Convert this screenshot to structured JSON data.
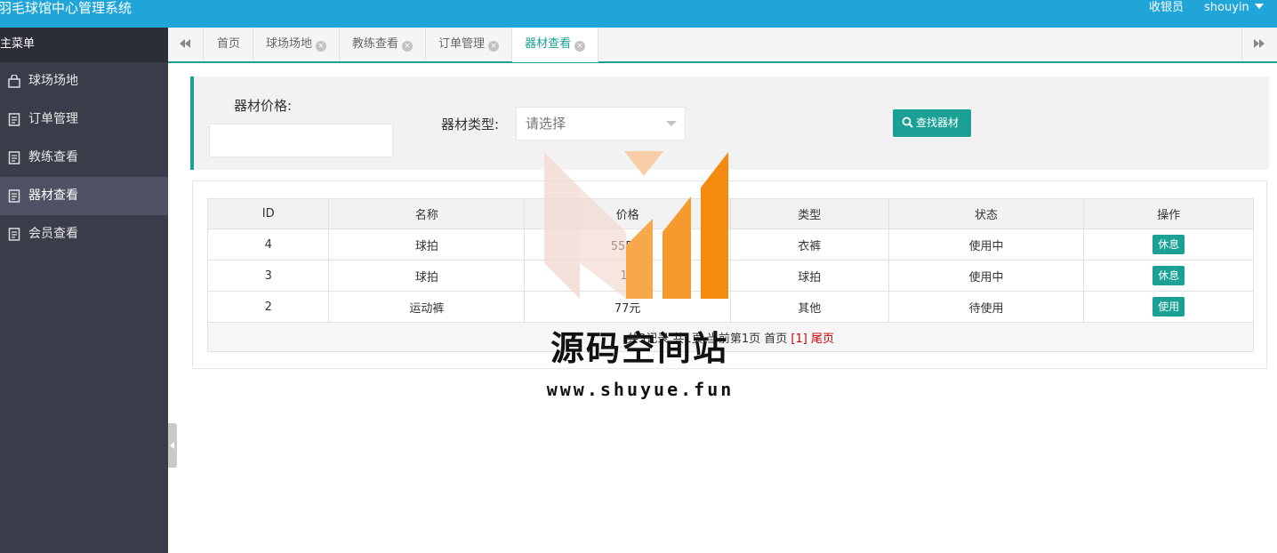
{
  "app": {
    "title": "羽毛球馆中心管理系统",
    "role": "收银员",
    "username": "shouyin"
  },
  "sidebar": {
    "header": "主菜单",
    "items": [
      {
        "label": "球场场地",
        "icon": "bag-icon",
        "active": false
      },
      {
        "label": "订单管理",
        "icon": "document-icon",
        "active": false
      },
      {
        "label": "教练查看",
        "icon": "document-icon",
        "active": false
      },
      {
        "label": "器材查看",
        "icon": "document-icon",
        "active": true
      },
      {
        "label": "会员查看",
        "icon": "document-icon",
        "active": false
      }
    ]
  },
  "tabs": [
    {
      "label": "首页",
      "closable": false,
      "active": false
    },
    {
      "label": "球场场地",
      "closable": true,
      "active": false
    },
    {
      "label": "教练查看",
      "closable": true,
      "active": false
    },
    {
      "label": "订单管理",
      "closable": true,
      "active": false
    },
    {
      "label": "器材查看",
      "closable": true,
      "active": true
    }
  ],
  "filter": {
    "price_label": "器材价格:",
    "price_value": "",
    "type_label": "器材类型:",
    "type_placeholder": "请选择",
    "search_button": "查找器材"
  },
  "table": {
    "columns": [
      "ID",
      "名称",
      "价格",
      "类型",
      "状态",
      "操作"
    ],
    "rows": [
      {
        "id": "4",
        "name": "球拍",
        "price": "555元",
        "type": "衣裤",
        "status": "使用中",
        "action": "休息"
      },
      {
        "id": "3",
        "name": "球拍",
        "price": "11",
        "type": "球拍",
        "status": "使用中",
        "action": "休息"
      },
      {
        "id": "2",
        "name": "运动裤",
        "price": "77元",
        "type": "其他",
        "status": "待使用",
        "action": "使用"
      }
    ],
    "pager": {
      "summary": "共3记录 共1页 当前第1页 首页",
      "current": "[1]",
      "last": "尾页"
    }
  },
  "watermark": {
    "title": "源码空间站",
    "url": "www.shuyue.fun"
  },
  "colors": {
    "topbar": "#1fa5d8",
    "sidebar": "#393d49",
    "accent": "#1aa094"
  }
}
